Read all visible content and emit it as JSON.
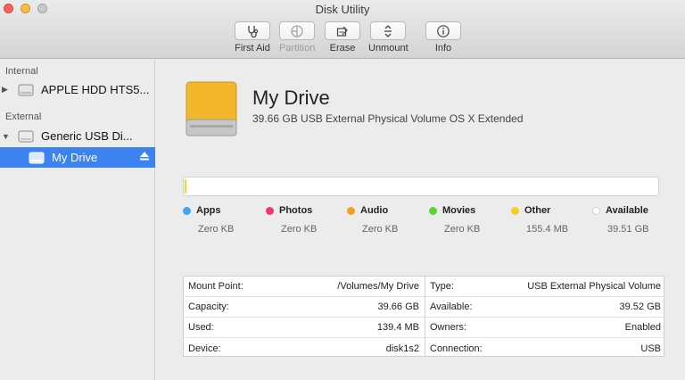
{
  "window": {
    "title": "Disk Utility"
  },
  "toolbar": {
    "first_aid": "First Aid",
    "partition": "Partition",
    "erase": "Erase",
    "unmount": "Unmount",
    "info": "Info"
  },
  "sidebar": {
    "internal_header": "Internal",
    "internal_disk": "APPLE HDD HTS5...",
    "external_header": "External",
    "external_disk": "Generic USB Di...",
    "volume": "My Drive"
  },
  "drive": {
    "name": "My Drive",
    "subtitle": "39.66 GB USB External Physical Volume OS X Extended",
    "used_fraction": 0.004
  },
  "legend": [
    {
      "label": "Apps",
      "value": "Zero KB",
      "color": "#3da5f4"
    },
    {
      "label": "Photos",
      "value": "Zero KB",
      "color": "#f0347e"
    },
    {
      "label": "Audio",
      "value": "Zero KB",
      "color": "#f6a021"
    },
    {
      "label": "Movies",
      "value": "Zero KB",
      "color": "#5dd138"
    },
    {
      "label": "Other",
      "value": "155.4 MB",
      "color": "#f7cf18"
    },
    {
      "label": "Available",
      "value": "39.51 GB",
      "color": "#ffffff"
    }
  ],
  "info": {
    "left": [
      {
        "label": "Mount Point:",
        "value": "/Volumes/My Drive"
      },
      {
        "label": "Capacity:",
        "value": "39.66 GB"
      },
      {
        "label": "Used:",
        "value": "139.4 MB"
      },
      {
        "label": "Device:",
        "value": "disk1s2"
      }
    ],
    "right": [
      {
        "label": "Type:",
        "value": "USB External Physical Volume"
      },
      {
        "label": "Available:",
        "value": "39.52 GB"
      },
      {
        "label": "Owners:",
        "value": "Enabled"
      },
      {
        "label": "Connection:",
        "value": "USB"
      }
    ]
  },
  "colors": {
    "selection": "#3c82f0",
    "drive_body": "#f2b72b"
  }
}
